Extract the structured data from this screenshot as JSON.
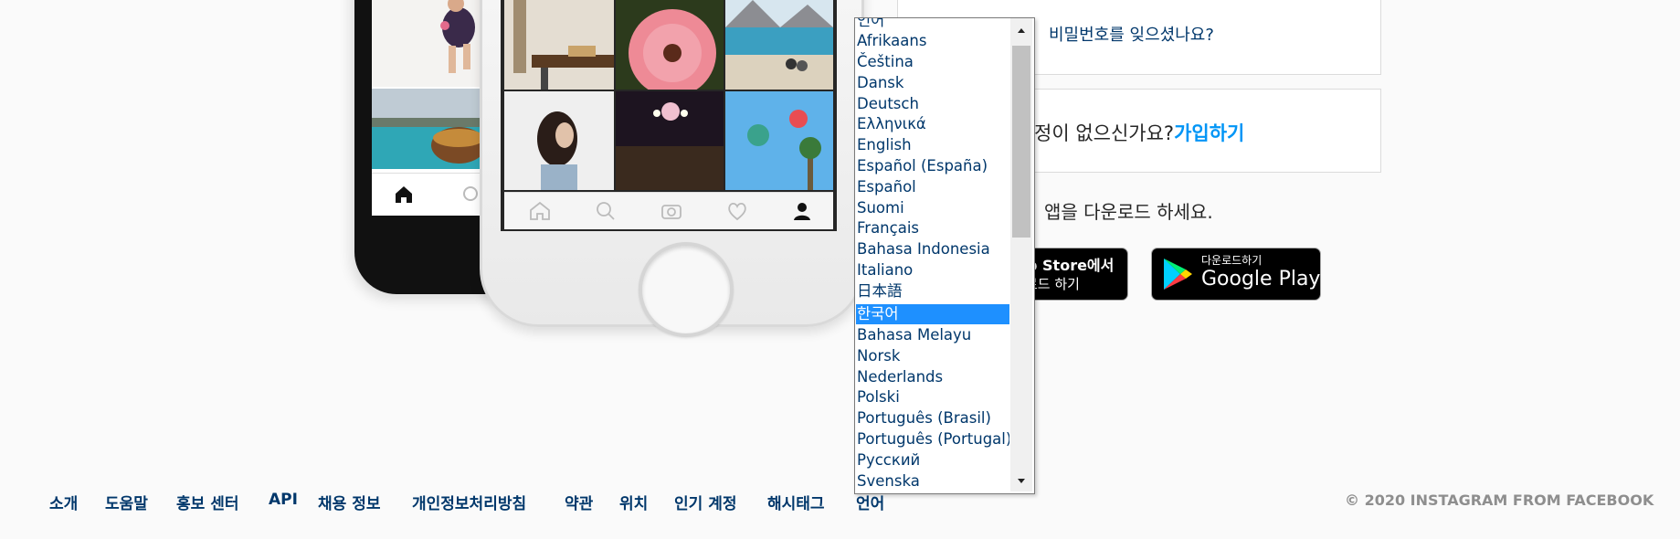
{
  "account": {
    "forgot_password": "비밀번호를 잊으셨나요?",
    "no_account_prefix": "정이 없으신가요?",
    "signup_link": "가입하기",
    "download_app": "앱을 다운로드 하세요."
  },
  "stores": {
    "appstore_line1": "p Store에서",
    "appstore_line2": "로드 하기",
    "googleplay_line1": "다운로드하기",
    "googleplay_line2": "Google Play"
  },
  "language_select": {
    "partial_top": "언어",
    "options": [
      "Afrikaans",
      "Čeština",
      "Dansk",
      "Deutsch",
      "Ελληνικά",
      "English",
      "Español (España)",
      "Español",
      "Suomi",
      "Français",
      "Bahasa Indonesia",
      "Italiano",
      "日本語",
      "한국어",
      "Bahasa Melayu",
      "Norsk",
      "Nederlands",
      "Polski",
      "Português (Brasil)",
      "Português (Portugal)",
      "Русский",
      "Svenska"
    ],
    "selected": "한국어"
  },
  "footer": {
    "links": [
      "소개",
      "도움말",
      "홍보 센터",
      "API",
      "채용 정보",
      "개인정보처리방침",
      "약관",
      "위치",
      "인기 계정",
      "해시태그",
      "언어"
    ],
    "copyright": "© 2020 INSTAGRAM FROM FACEBOOK"
  },
  "colors": {
    "link_blue": "#0095f6",
    "footer_link": "#00376b",
    "selected_option": "#1e90ff",
    "background": "#fafafa"
  },
  "icons": [
    "home-icon",
    "search-icon",
    "camera-icon",
    "heart-icon",
    "profile-icon",
    "google-play-icon",
    "scroll-up-arrow-icon",
    "scroll-down-arrow-icon"
  ]
}
